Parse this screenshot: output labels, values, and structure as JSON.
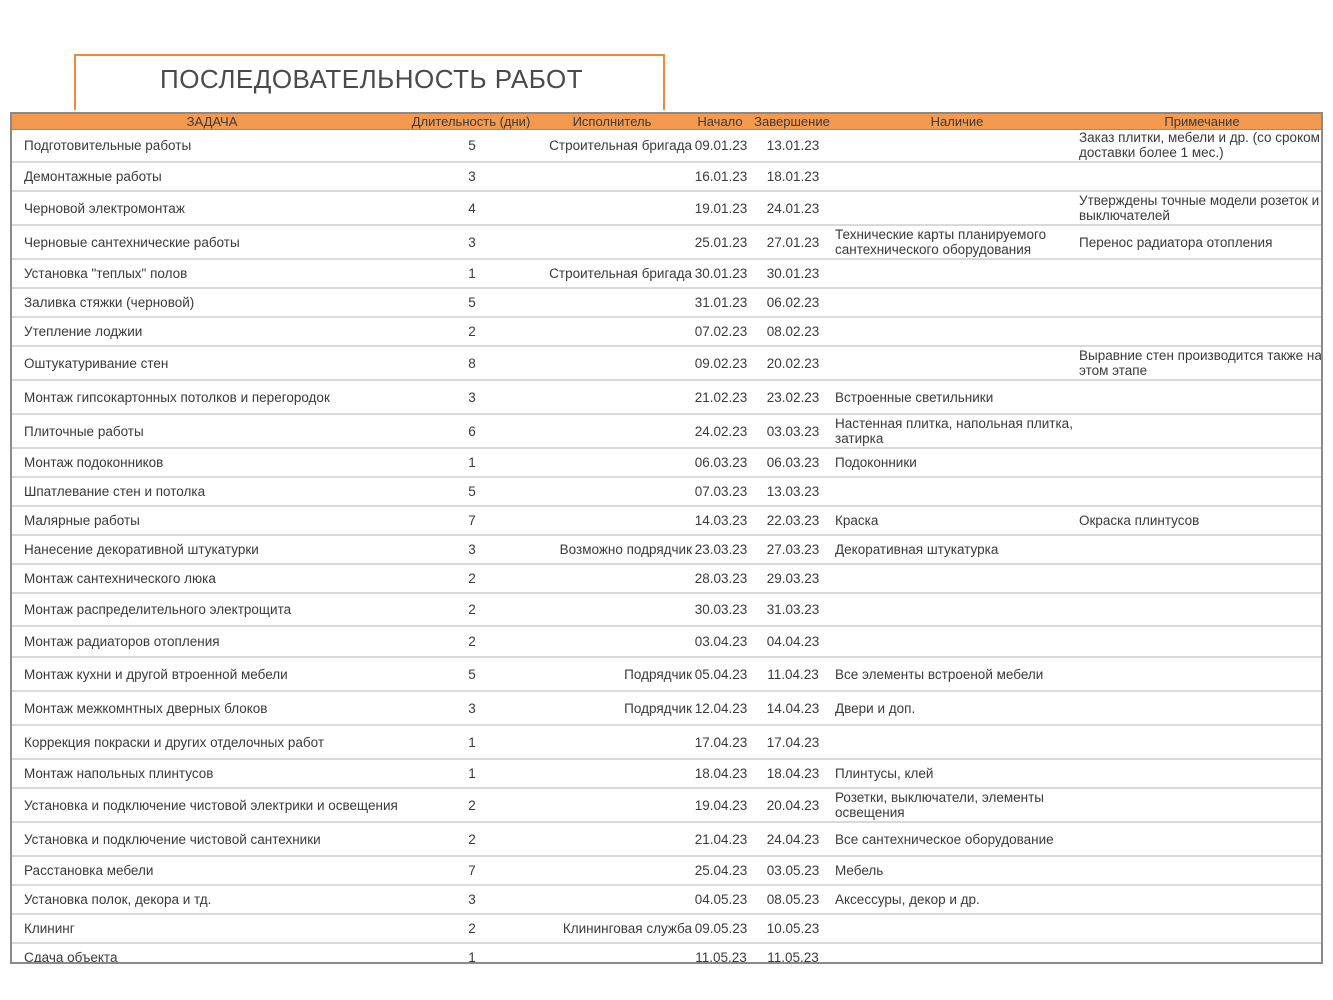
{
  "title": "ПОСЛЕДОВАТЕЛЬНОСТЬ РАБОТ",
  "colors": {
    "accent": "#f39a4f",
    "border": "#f0883e"
  },
  "headers": {
    "task": "ЗАДАЧА",
    "duration": "Длительность (дни)",
    "assignee": "Исполнитель",
    "start": "Начало",
    "end": "Завершение",
    "availability": "Наличие",
    "note": "Примечание"
  },
  "rows": [
    {
      "task": "Подготовительные работы",
      "duration": "5",
      "assignee": "Строительная бригада",
      "start": "09.01.23",
      "end": "13.01.23",
      "availability": "",
      "note": "Заказ плитки, мебели и др. (со сроком доставки более 1 мес.)"
    },
    {
      "task": "Демонтажные работы",
      "duration": "3",
      "assignee": "",
      "start": "16.01.23",
      "end": "18.01.23",
      "availability": "",
      "note": ""
    },
    {
      "task": "Черновой электромонтаж",
      "duration": "4",
      "assignee": "",
      "start": "19.01.23",
      "end": "24.01.23",
      "availability": "",
      "note": "Утверждены точные модели розеток и выключателей"
    },
    {
      "task": "Черновые сантехнические работы",
      "duration": "3",
      "assignee": "",
      "start": "25.01.23",
      "end": "27.01.23",
      "availability": "Технические карты планируемого сантехнического оборудования",
      "note": "Перенос радиатора отопления"
    },
    {
      "task": "Установка \"теплых\" полов",
      "duration": "1",
      "assignee": "Строительная бригада",
      "start": "30.01.23",
      "end": "30.01.23",
      "availability": "",
      "note": ""
    },
    {
      "task": "Заливка стяжки (черновой)",
      "duration": "5",
      "assignee": "",
      "start": "31.01.23",
      "end": "06.02.23",
      "availability": "",
      "note": ""
    },
    {
      "task": "Утепление лоджии",
      "duration": "2",
      "assignee": "",
      "start": "07.02.23",
      "end": "08.02.23",
      "availability": "",
      "note": ""
    },
    {
      "task": "Оштукатуривание стен",
      "duration": "8",
      "assignee": "",
      "start": "09.02.23",
      "end": "20.02.23",
      "availability": "",
      "note": "Выравние стен производится также на этом этапе"
    },
    {
      "task": "Монтаж гипсокартонных потолков и перегородок",
      "duration": "3",
      "assignee": "",
      "start": "21.02.23",
      "end": "23.02.23",
      "availability": "Встроенные светильники",
      "note": ""
    },
    {
      "task": "Плиточные работы",
      "duration": "6",
      "assignee": "",
      "start": "24.02.23",
      "end": "03.03.23",
      "availability": "Настенная плитка, напольная плитка, затирка",
      "note": ""
    },
    {
      "task": "Монтаж подоконников",
      "duration": "1",
      "assignee": "",
      "start": "06.03.23",
      "end": "06.03.23",
      "availability": "Подоконники",
      "note": ""
    },
    {
      "task": "Шпатлевание стен и потолка",
      "duration": "5",
      "assignee": "",
      "start": "07.03.23",
      "end": "13.03.23",
      "availability": "",
      "note": ""
    },
    {
      "task": "Малярные работы",
      "duration": "7",
      "assignee": "",
      "start": "14.03.23",
      "end": "22.03.23",
      "availability": "Краска",
      "note": "Окраска плинтусов"
    },
    {
      "task": "Нанесение декоративной штукатурки",
      "duration": "3",
      "assignee": "Возможно подрядчик",
      "start": "23.03.23",
      "end": "27.03.23",
      "availability": "Декоративная штукатурка",
      "note": ""
    },
    {
      "task": "Монтаж сантехнического люка",
      "duration": "2",
      "assignee": "",
      "start": "28.03.23",
      "end": "29.03.23",
      "availability": "",
      "note": ""
    },
    {
      "task": "Монтаж распределительного электрощита",
      "duration": "2",
      "assignee": "",
      "start": "30.03.23",
      "end": "31.03.23",
      "availability": "",
      "note": ""
    },
    {
      "task": "Монтаж радиаторов отопления",
      "duration": "2",
      "assignee": "",
      "start": "03.04.23",
      "end": "04.04.23",
      "availability": "",
      "note": ""
    },
    {
      "task": "Монтаж кухни и другой втроенной мебели",
      "duration": "5",
      "assignee": "Подрядчик",
      "start": "05.04.23",
      "end": "11.04.23",
      "availability": "Все элементы встроеной мебели",
      "note": ""
    },
    {
      "task": "Монтаж межкомнтных дверных блоков",
      "duration": "3",
      "assignee": "Подрядчик",
      "start": "12.04.23",
      "end": "14.04.23",
      "availability": "Двери и доп.",
      "note": ""
    },
    {
      "task": "Коррекция покраски и других отделочных работ",
      "duration": "1",
      "assignee": "",
      "start": "17.04.23",
      "end": "17.04.23",
      "availability": "",
      "note": ""
    },
    {
      "task": "Монтаж напольных плинтусов",
      "duration": "1",
      "assignee": "",
      "start": "18.04.23",
      "end": "18.04.23",
      "availability": "Плинтусы, клей",
      "note": ""
    },
    {
      "task": "Установка и подключение чистовой электрики и освещения",
      "duration": "2",
      "assignee": "",
      "start": "19.04.23",
      "end": "20.04.23",
      "availability": "Розетки, выключатели, элементы освещения",
      "note": ""
    },
    {
      "task": "Установка и подключение чистовой сантехники",
      "duration": "2",
      "assignee": "",
      "start": "21.04.23",
      "end": "24.04.23",
      "availability": "Все сантехническое оборудование",
      "note": ""
    },
    {
      "task": "Расстановка мебели",
      "duration": "7",
      "assignee": "",
      "start": "25.04.23",
      "end": "03.05.23",
      "availability": "Мебель",
      "note": ""
    },
    {
      "task": "Установка полок, декора и тд.",
      "duration": "3",
      "assignee": "",
      "start": "04.05.23",
      "end": "08.05.23",
      "availability": "Аксессуры, декор и др.",
      "note": ""
    },
    {
      "task": "Клининг",
      "duration": "2",
      "assignee": "Клининговая служба",
      "start": "09.05.23",
      "end": "10.05.23",
      "availability": "",
      "note": ""
    },
    {
      "task": "Сдача объекта",
      "duration": "1",
      "assignee": "",
      "start": "11.05.23",
      "end": "11.05.23",
      "availability": "",
      "note": ""
    }
  ]
}
